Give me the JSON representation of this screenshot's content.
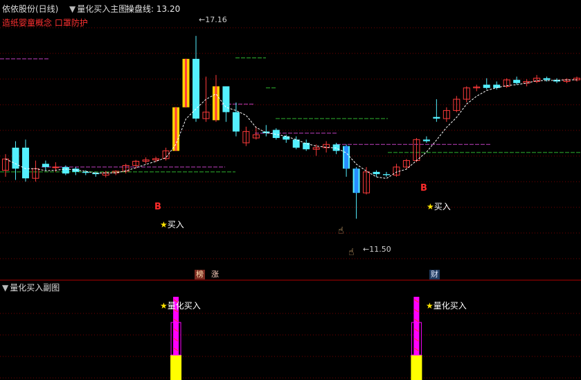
{
  "header": {
    "stock_name": "依依股份(日线)",
    "indicator_name": "量化买入主图",
    "line_label": "操盘线:",
    "line_value": "13.20"
  },
  "concepts": "造纸婴童概念 口罩防护",
  "price_high": "17.16",
  "price_low": "11.50",
  "buy_label": "买入",
  "b_label": "B",
  "tags": [
    "榜",
    "涨",
    "财"
  ],
  "sub_chart": {
    "title": "量化买入副图",
    "buy_label": "量化买入"
  },
  "colors": {
    "up": "#ff3b3b",
    "down": "#54f0ff",
    "limit_up": "#ffd400",
    "ma": "#ffffff",
    "magenta": "#c040c0",
    "green": "#2fb52f",
    "blue_signal": "#1e7bff"
  },
  "chart_data": {
    "type": "candlestick",
    "ylim": [
      10.8,
      17.8
    ],
    "candles": [
      {
        "o": 13.0,
        "h": 13.5,
        "l": 12.8,
        "c": 13.35
      },
      {
        "o": 13.7,
        "h": 13.9,
        "l": 12.7,
        "c": 13.05
      },
      {
        "o": 13.7,
        "h": 13.95,
        "l": 12.65,
        "c": 12.75
      },
      {
        "o": 12.75,
        "h": 13.3,
        "l": 12.65,
        "c": 13.05
      },
      {
        "o": 13.2,
        "h": 13.3,
        "l": 13.0,
        "c": 13.1
      },
      {
        "o": 13.1,
        "h": 13.25,
        "l": 12.95,
        "c": 13.1
      },
      {
        "o": 13.1,
        "h": 13.15,
        "l": 12.85,
        "c": 12.9
      },
      {
        "o": 13.05,
        "h": 13.1,
        "l": 12.85,
        "c": 12.95
      },
      {
        "o": 12.95,
        "h": 13.0,
        "l": 12.85,
        "c": 12.92
      },
      {
        "o": 12.92,
        "h": 12.95,
        "l": 12.8,
        "c": 12.88
      },
      {
        "o": 12.85,
        "h": 12.98,
        "l": 12.78,
        "c": 12.92
      },
      {
        "o": 12.92,
        "h": 13.0,
        "l": 12.85,
        "c": 12.97
      },
      {
        "o": 12.97,
        "h": 13.2,
        "l": 12.9,
        "c": 13.15
      },
      {
        "o": 13.15,
        "h": 13.32,
        "l": 13.05,
        "c": 13.28
      },
      {
        "o": 13.28,
        "h": 13.4,
        "l": 13.2,
        "c": 13.32
      },
      {
        "o": 13.32,
        "h": 13.42,
        "l": 13.25,
        "c": 13.36
      },
      {
        "o": 13.36,
        "h": 13.7,
        "l": 13.3,
        "c": 13.6
      },
      {
        "o": 13.6,
        "h": 14.95,
        "l": 13.6,
        "c": 14.95,
        "limit": true
      },
      {
        "o": 14.95,
        "h": 16.45,
        "l": 14.95,
        "c": 16.45,
        "limit": true
      },
      {
        "o": 16.45,
        "h": 17.16,
        "l": 14.5,
        "c": 14.6
      },
      {
        "o": 14.6,
        "h": 15.9,
        "l": 14.5,
        "c": 14.8
      },
      {
        "o": 14.55,
        "h": 15.95,
        "l": 14.5,
        "c": 15.6,
        "limit": true
      },
      {
        "o": 15.6,
        "h": 15.6,
        "l": 14.5,
        "c": 14.8
      },
      {
        "o": 14.8,
        "h": 15.1,
        "l": 14.05,
        "c": 14.2
      },
      {
        "o": 13.85,
        "h": 14.35,
        "l": 13.75,
        "c": 14.2
      },
      {
        "o": 14.0,
        "h": 14.35,
        "l": 13.95,
        "c": 14.1
      },
      {
        "o": 14.2,
        "h": 14.4,
        "l": 14.05,
        "c": 14.15
      },
      {
        "o": 14.25,
        "h": 14.3,
        "l": 13.95,
        "c": 14.0
      },
      {
        "o": 14.05,
        "h": 14.1,
        "l": 13.85,
        "c": 13.95
      },
      {
        "o": 13.95,
        "h": 14.05,
        "l": 13.65,
        "c": 13.7
      },
      {
        "o": 13.85,
        "h": 13.95,
        "l": 13.6,
        "c": 13.65
      },
      {
        "o": 13.65,
        "h": 13.8,
        "l": 13.45,
        "c": 13.7
      },
      {
        "o": 13.7,
        "h": 13.9,
        "l": 13.55,
        "c": 13.8
      },
      {
        "o": 13.8,
        "h": 13.85,
        "l": 13.5,
        "c": 13.6
      },
      {
        "o": 13.75,
        "h": 13.8,
        "l": 12.8,
        "c": 13.05
      },
      {
        "o": 13.05,
        "h": 13.1,
        "l": 11.5,
        "c": 12.3
      },
      {
        "o": 12.3,
        "h": 13.1,
        "l": 12.25,
        "c": 12.95
      },
      {
        "o": 12.95,
        "h": 13.0,
        "l": 12.8,
        "c": 12.88
      },
      {
        "o": 12.88,
        "h": 12.95,
        "l": 12.8,
        "c": 12.85
      },
      {
        "o": 12.85,
        "h": 13.2,
        "l": 12.8,
        "c": 13.1
      },
      {
        "o": 13.1,
        "h": 13.35,
        "l": 13.05,
        "c": 13.3
      },
      {
        "o": 13.3,
        "h": 14.0,
        "l": 13.25,
        "c": 13.95
      },
      {
        "o": 13.95,
        "h": 14.05,
        "l": 13.85,
        "c": 13.9
      },
      {
        "o": 14.65,
        "h": 15.2,
        "l": 14.5,
        "c": 14.6
      },
      {
        "o": 14.6,
        "h": 14.95,
        "l": 14.5,
        "c": 14.85
      },
      {
        "o": 14.85,
        "h": 15.3,
        "l": 14.8,
        "c": 15.2
      },
      {
        "o": 15.2,
        "h": 15.6,
        "l": 15.1,
        "c": 15.55
      },
      {
        "o": 15.55,
        "h": 15.65,
        "l": 15.45,
        "c": 15.58
      },
      {
        "o": 15.65,
        "h": 15.85,
        "l": 15.5,
        "c": 15.55
      },
      {
        "o": 15.65,
        "h": 15.75,
        "l": 15.5,
        "c": 15.55
      },
      {
        "o": 15.6,
        "h": 15.85,
        "l": 15.55,
        "c": 15.8
      },
      {
        "o": 15.8,
        "h": 15.9,
        "l": 15.65,
        "c": 15.7
      },
      {
        "o": 15.7,
        "h": 15.82,
        "l": 15.6,
        "c": 15.75
      },
      {
        "o": 15.75,
        "h": 15.95,
        "l": 15.7,
        "c": 15.85
      },
      {
        "o": 15.85,
        "h": 15.9,
        "l": 15.75,
        "c": 15.8
      },
      {
        "o": 15.8,
        "h": 15.85,
        "l": 15.7,
        "c": 15.75
      },
      {
        "o": 15.75,
        "h": 15.85,
        "l": 15.7,
        "c": 15.8
      },
      {
        "o": 15.8,
        "h": 15.9,
        "l": 15.75,
        "c": 15.85
      }
    ]
  }
}
